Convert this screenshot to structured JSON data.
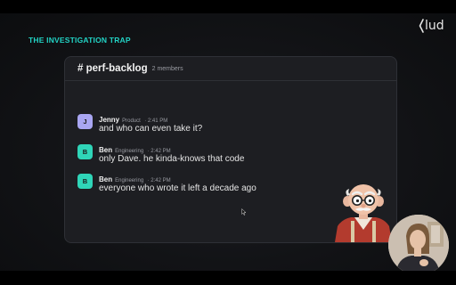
{
  "slide": {
    "heading": "THE INVESTIGATION TRAP",
    "brand": "lud"
  },
  "channel": {
    "name": "# perf-backlog",
    "member_count": "2 members"
  },
  "messages": [
    {
      "initial": "J",
      "sender": "Jenny",
      "role": "Product",
      "time": "· 2:41 PM",
      "text": "and who can even take it?",
      "avatar_color": "#a9a6f2"
    },
    {
      "initial": "B",
      "sender": "Ben",
      "role": "Engineering",
      "time": "· 2:42 PM",
      "text": "only Dave. he kinda-knows that code",
      "avatar_color": "#2fd5b8"
    },
    {
      "initial": "B",
      "sender": "Ben",
      "role": "Engineering",
      "time": "· 2:42 PM",
      "text": "everyone who wrote it left a decade ago",
      "avatar_color": "#2fd5b8"
    }
  ],
  "colors": {
    "accent": "#22d3c5",
    "panel": "#1d1e22"
  },
  "icons": {
    "brand": "hud-logo-icon",
    "mascot": "old-man-mascot-icon",
    "cursor": "mouse-pointer-icon",
    "webcam": "presenter-webcam"
  }
}
